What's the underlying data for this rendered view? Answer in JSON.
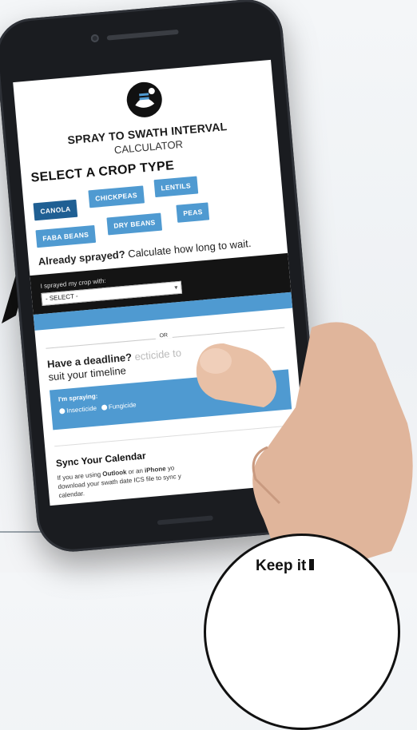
{
  "app": {
    "title_line1": "SPRAY TO SWATH INTERVAL",
    "title_line2": "CALCULATOR"
  },
  "crop_section": {
    "heading": "SELECT A CROP TYPE",
    "crops": [
      "CANOLA",
      "CHICKPEAS",
      "LENTILS",
      "FABA BEANS",
      "DRY BEANS",
      "PEAS"
    ],
    "active": "CANOLA"
  },
  "sprayed_section": {
    "question_bold": "Already sprayed?",
    "question_rest": "Calculate how long to wait.",
    "select_label": "I sprayed my crop with:",
    "select_value": "- SELECT -"
  },
  "or_label": "OR",
  "deadline_section": {
    "question_bold": "Have a deadline?",
    "question_rest": "suit your timeline",
    "question_tail": "ecticide to",
    "panel_label": "I'm spraying:",
    "options": [
      "Insecticide",
      "Fungicide"
    ]
  },
  "sync_section": {
    "heading": "Sync Your Calendar",
    "text_1": "If you are using",
    "outlook": "Outlook",
    "text_2": "or an",
    "iphone": "iPhone",
    "text_3": "yo",
    "text_4": "download your swath date ICS file to sync y",
    "text_5": "calendar."
  },
  "badge": {
    "text": "Keep it"
  },
  "colors": {
    "accent_blue": "#4f9ad1",
    "active_blue": "#1f5f93",
    "dark_panel": "#141414"
  }
}
